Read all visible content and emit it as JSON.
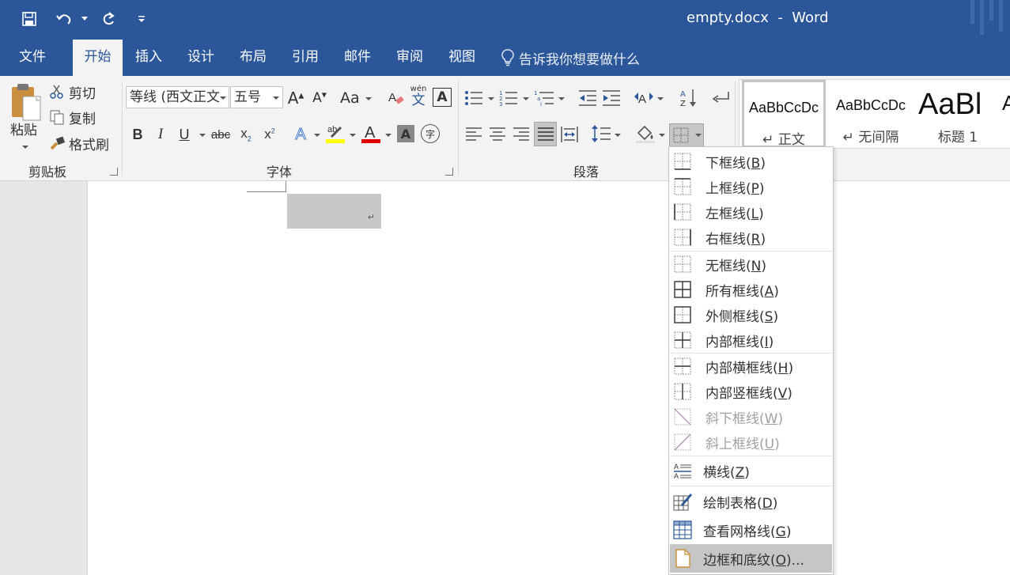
{
  "window": {
    "title": "empty.docx  -  Word"
  },
  "menu_tabs": [
    {
      "label": "文件"
    },
    {
      "label": "开始"
    },
    {
      "label": "插入"
    },
    {
      "label": "设计"
    },
    {
      "label": "布局"
    },
    {
      "label": "引用"
    },
    {
      "label": "邮件"
    },
    {
      "label": "审阅"
    },
    {
      "label": "视图"
    }
  ],
  "tell_me": "告诉我你想要做什么",
  "clipboard": {
    "paste": "粘贴",
    "cut": "剪切",
    "copy": "复制",
    "format_painter": "格式刷",
    "label": "剪贴板"
  },
  "font": {
    "name": "等线 (西文正文",
    "size": "五号",
    "label": "字体",
    "case_label": "Aa",
    "phonetic_label": "wén",
    "phonetic_char": "文"
  },
  "paragraph": {
    "label": "段落"
  },
  "styles": [
    {
      "sample": "AaBbCcDc",
      "name": "↵ 正文"
    },
    {
      "sample": "AaBbCcDc",
      "name": "↵ 无间隔"
    },
    {
      "sample": "AaBl",
      "name": "标题 1"
    },
    {
      "sample": "A",
      "name": ""
    }
  ],
  "border_menu": {
    "items": [
      {
        "label": "下框线",
        "key": "B",
        "enabled": true
      },
      {
        "label": "上框线",
        "key": "P",
        "enabled": true
      },
      {
        "label": "左框线",
        "key": "L",
        "enabled": true
      },
      {
        "label": "右框线",
        "key": "R",
        "enabled": true
      },
      {
        "label": "无框线",
        "key": "N",
        "enabled": true
      },
      {
        "label": "所有框线",
        "key": "A",
        "enabled": true
      },
      {
        "label": "外侧框线",
        "key": "S",
        "enabled": true
      },
      {
        "label": "内部框线",
        "key": "I",
        "enabled": true
      },
      {
        "label": "内部横框线",
        "key": "H",
        "enabled": true
      },
      {
        "label": "内部竖框线",
        "key": "V",
        "enabled": true
      },
      {
        "label": "斜下框线",
        "key": "W",
        "enabled": false
      },
      {
        "label": "斜上框线",
        "key": "U",
        "enabled": false
      },
      {
        "label": "横线",
        "key": "Z",
        "enabled": true
      },
      {
        "label": "绘制表格",
        "key": "D",
        "enabled": true
      },
      {
        "label": "查看网格线",
        "key": "G",
        "enabled": true
      },
      {
        "label": "边框和底纹",
        "key": "O",
        "suffix": "...",
        "enabled": true
      }
    ]
  },
  "colors": {
    "title_bar": "#2b579a",
    "ribbon_bg": "#f3f3f3",
    "highlight_yellow": "#ffff00",
    "font_red": "#e00000"
  }
}
